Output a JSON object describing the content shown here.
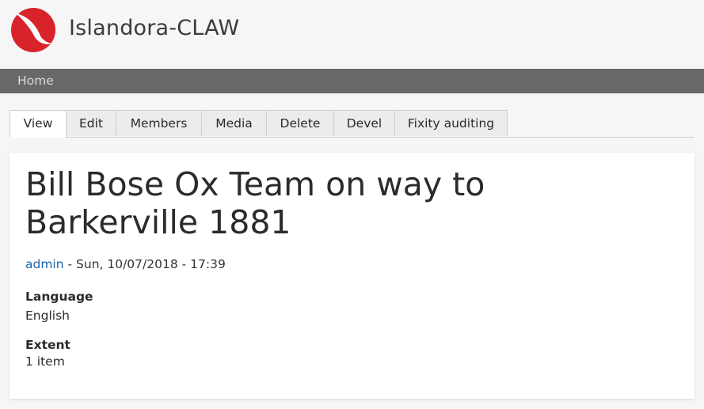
{
  "site": {
    "name": "Islandora-CLAW",
    "logo_icon": "islandora-logo-icon",
    "brand_color": "#d8232a"
  },
  "nav": {
    "home": "Home"
  },
  "tabs": [
    {
      "label": "View",
      "active": true
    },
    {
      "label": "Edit"
    },
    {
      "label": "Members"
    },
    {
      "label": "Media"
    },
    {
      "label": "Delete"
    },
    {
      "label": "Devel"
    },
    {
      "label": "Fixity auditing"
    }
  ],
  "node": {
    "title": "Bill Bose Ox Team on way to Barkerville 1881",
    "author": "admin",
    "date": " - Sun, 10/07/2018 - 17:39",
    "fields": [
      {
        "label": "Language",
        "value": "English"
      },
      {
        "label": "Extent",
        "value": "1 item"
      }
    ]
  },
  "colors": {
    "link": "#1a64a8",
    "navbar": "#686868"
  }
}
